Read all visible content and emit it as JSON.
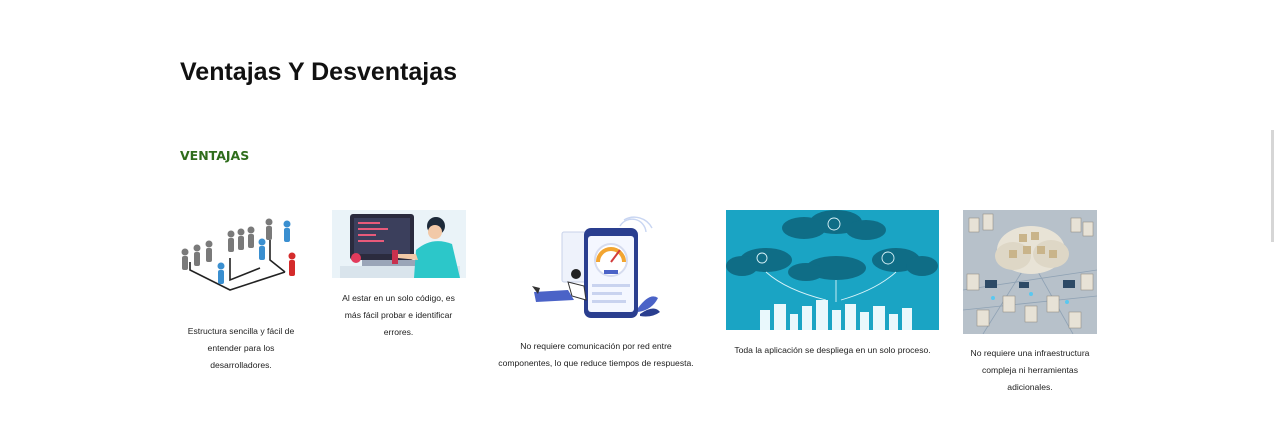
{
  "section": {
    "title": "Ventajas Y Desventajas",
    "subtitle": "VENTAJAS"
  },
  "cards": [
    {
      "image": "hierarchy-people-illustration",
      "text": "Estructura sencilla y fácil de entender para los desarrolladores."
    },
    {
      "image": "developer-coding-illustration",
      "text": "Al estar en un solo código, es más fácil probar e identificar errores."
    },
    {
      "image": "speed-gauge-phone-illustration",
      "text": "No requiere comunicación por red entre componentes, lo que reduce tiempos de respuesta."
    },
    {
      "image": "cloud-city-network-illustration",
      "text": "Toda la aplicación se despliega en un solo proceso."
    },
    {
      "image": "cloud-infrastructure-illustration",
      "text": "No requiere una infraestructura compleja ni herramientas adicionales."
    }
  ],
  "colors": {
    "subtitle": "#2f6d1c",
    "cloud_banner": "#1aa4c4",
    "developer_shirt": "#2cc7c9"
  }
}
